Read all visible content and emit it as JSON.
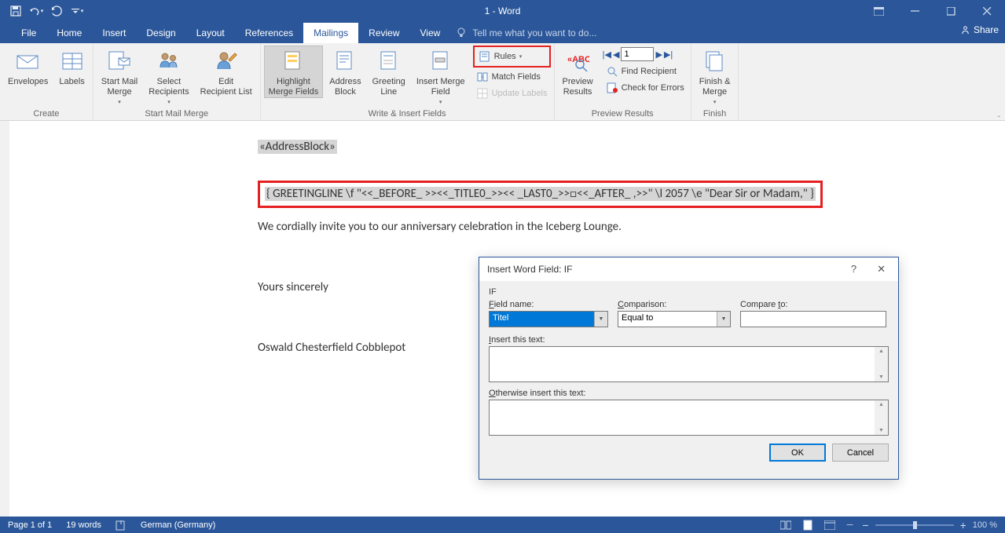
{
  "title": "1 - Word",
  "tabs": {
    "file": "File",
    "home": "Home",
    "insert": "Insert",
    "design": "Design",
    "layout": "Layout",
    "references": "References",
    "mailings": "Mailings",
    "review": "Review",
    "view": "View",
    "tellme": "Tell me what you want to do..."
  },
  "share": "Share",
  "ribbon": {
    "create": {
      "envelopes": "Envelopes",
      "labels": "Labels",
      "group": "Create"
    },
    "start": {
      "startmm": "Start Mail\nMerge",
      "select": "Select\nRecipients",
      "edit": "Edit\nRecipient List",
      "group": "Start Mail Merge"
    },
    "write": {
      "highlight": "Highlight\nMerge Fields",
      "address": "Address\nBlock",
      "greeting": "Greeting\nLine",
      "insertmf": "Insert Merge\nField",
      "rules": "Rules",
      "match": "Match Fields",
      "update": "Update Labels",
      "group": "Write & Insert Fields"
    },
    "preview": {
      "preview": "Preview\nResults",
      "find": "Find Recipient",
      "check": "Check for Errors",
      "record": "1",
      "group": "Preview Results"
    },
    "finish": {
      "finish": "Finish &\nMerge",
      "group": "Finish"
    }
  },
  "doc": {
    "address_block": "«AddressBlock»",
    "greeting_code": "{ GREETINGLINE \\f \"<<_BEFORE_ >><<_TITLE0_>><< _LAST0_>>□<<_AFTER_ ,>>\" \\l 2057 \\e \"Dear Sir or Madam,\" }",
    "body": "We cordially invite you to our anniversary celebration in the Iceberg Lounge.",
    "closing": "Yours sincerely",
    "signature": "Oswald Chesterfield Cobblepot"
  },
  "dialog": {
    "title": "Insert Word Field: IF",
    "group": "IF",
    "fieldname_label": "Field name:",
    "fieldname_value": "Titel",
    "comparison_label": "Comparison:",
    "comparison_value": "Equal to",
    "compareto_label": "Compare to:",
    "insert_label": "Insert this text:",
    "otherwise_label": "Otherwise insert this text:",
    "ok": "OK",
    "cancel": "Cancel"
  },
  "status": {
    "page": "Page 1 of 1",
    "words": "19 words",
    "lang": "German (Germany)",
    "zoom": "100 %"
  }
}
